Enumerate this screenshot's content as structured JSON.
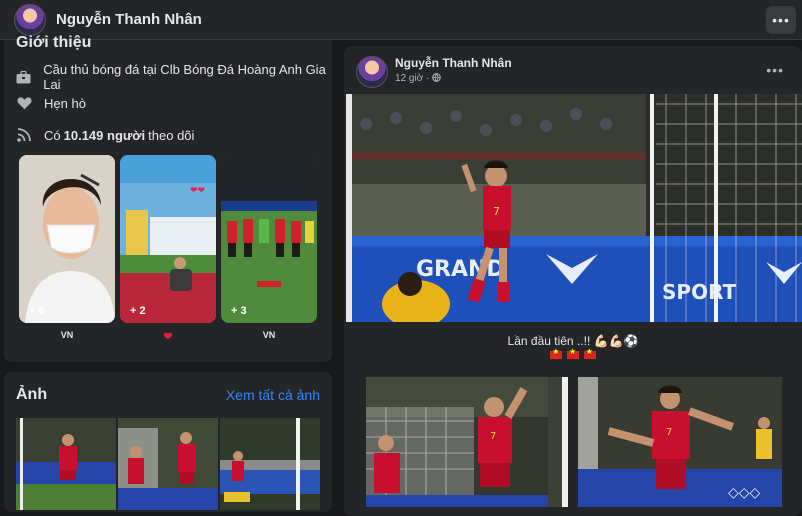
{
  "header": {
    "name": "Nguyễn Thanh Nhân",
    "more": "•••"
  },
  "intro": {
    "title": "Giới thiệu",
    "work": "Cầu thủ bóng đá tại Clb Bóng Đá Hoàng Anh Gia Lai",
    "relationship": "Hẹn hò",
    "followers_prefix": "Có ",
    "followers_count": "10.149 người",
    "followers_suffix": " theo dõi"
  },
  "stories": [
    {
      "count": "+ 6",
      "caption": "VN"
    },
    {
      "count": "+ 2",
      "caption": "❤"
    },
    {
      "count": "+ 3",
      "caption": "VN"
    }
  ],
  "photos": {
    "title": "Ảnh",
    "see_all": "Xem tất cả ảnh"
  },
  "post": {
    "author": "Nguyễn Thanh Nhân",
    "time": "12 giờ · ",
    "more": "•••",
    "caption": "Lần đầu tiên ..!! 💪🏻💪🏻⚽",
    "jersey_number": "7",
    "board_text_1": "GRAND",
    "board_text_2": "SPORT"
  },
  "colors": {
    "bg": "#18191a",
    "card": "#242526",
    "link": "#2d88ff",
    "jersey": "#c8102e"
  }
}
